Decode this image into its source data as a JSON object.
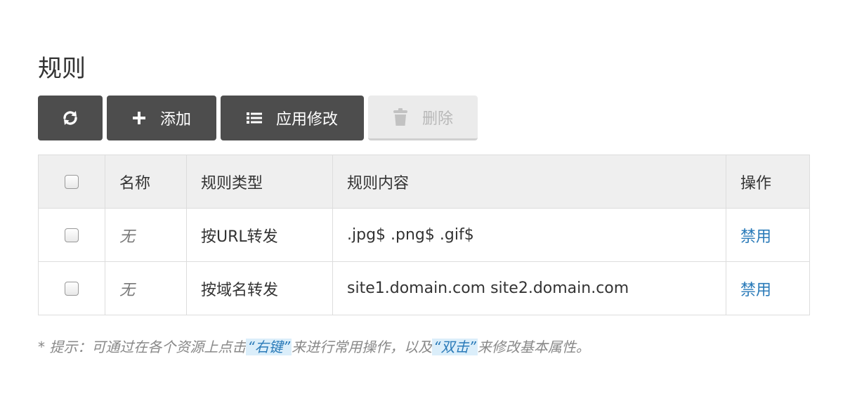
{
  "page": {
    "title": "规则"
  },
  "toolbar": {
    "add_label": "添加",
    "apply_label": "应用修改",
    "delete_label": "删除"
  },
  "table": {
    "headers": [
      "名称",
      "规则类型",
      "规则内容",
      "操作"
    ],
    "rows": [
      {
        "name": "无",
        "type": "按URL转发",
        "content": ".jpg$ .png$ .gif$",
        "action": "禁用"
      },
      {
        "name": "无",
        "type": "按域名转发",
        "content": "site1.domain.com site2.domain.com",
        "action": "禁用"
      }
    ]
  },
  "tip": {
    "prefix": "* 提示：可通过在各个资源上点击",
    "right_click": "“右键”",
    "middle": "来进行常用操作，以及",
    "double_click": "“双击”",
    "suffix": "来修改基本属性。"
  },
  "colors": {
    "button_dark": "#4d4d4d",
    "link": "#2b7bb9",
    "header_bg": "#efefef"
  }
}
